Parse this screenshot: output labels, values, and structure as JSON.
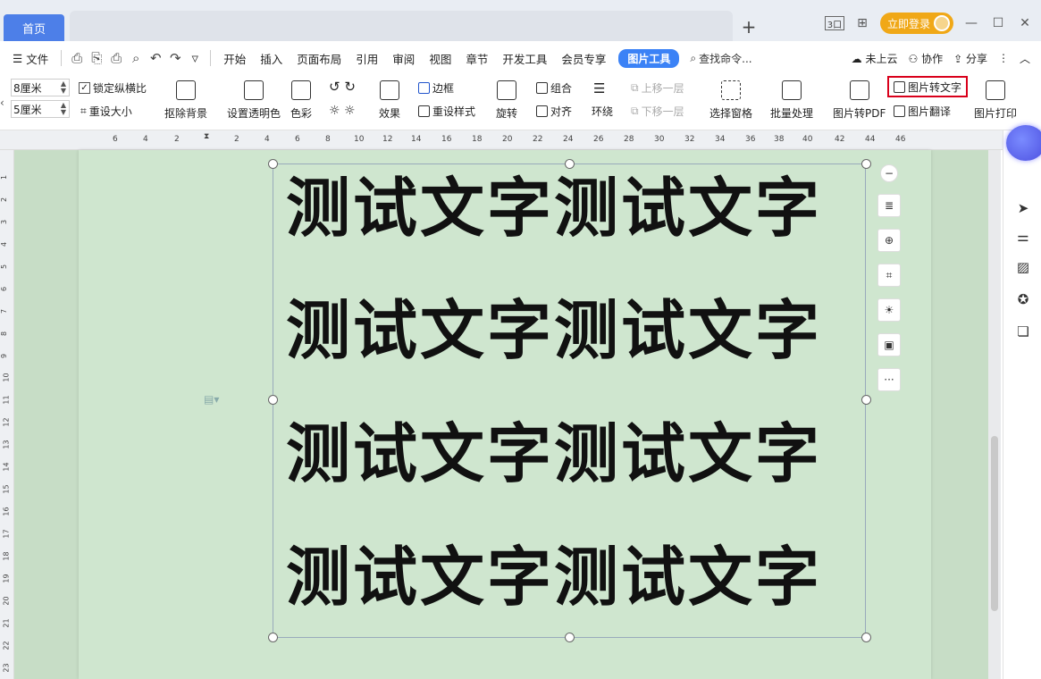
{
  "tabs": {
    "home": "首页",
    "new_tab": "+"
  },
  "title_right": {
    "view_icon": "3口",
    "login": "立即登录"
  },
  "menu": {
    "file": "文件",
    "items": [
      "开始",
      "插入",
      "页面布局",
      "引用",
      "审阅",
      "视图",
      "章节",
      "开发工具",
      "会员专享"
    ],
    "active": "图片工具",
    "search": "查找命令...",
    "right": [
      "未上云",
      "协作",
      "分享"
    ]
  },
  "ribbon": {
    "height_value": "8厘米",
    "width_value": "5厘米",
    "lock_ratio": "锁定纵横比",
    "reset_size": "重设大小",
    "remove_bg": "抠除背景",
    "set_transparent": "设置透明色",
    "color": "色彩",
    "effects": "效果",
    "border": "边框",
    "reset_style": "重设样式",
    "rotate": "旋转",
    "group": "组合",
    "align": "对齐",
    "wrap": "环绕",
    "bring_forward": "上移一层",
    "send_backward": "下移一层",
    "selection_pane": "选择窗格",
    "batch": "批量处理",
    "to_pdf": "图片转PDF",
    "to_text": "图片转文字",
    "translate": "图片翻译",
    "print": "图片打印"
  },
  "ruler_ticks": [
    "6",
    "4",
    "2",
    "2",
    "4",
    "6",
    "8",
    "10",
    "12",
    "14",
    "16",
    "18",
    "20",
    "22",
    "24",
    "26",
    "28",
    "30",
    "32",
    "34",
    "36",
    "38",
    "40",
    "42",
    "44",
    "46"
  ],
  "vruler_ticks": [
    "1",
    "2",
    "3",
    "4",
    "5",
    "6",
    "7",
    "8",
    "9",
    "10",
    "11",
    "12",
    "13",
    "14",
    "15",
    "16",
    "17",
    "18",
    "19",
    "20",
    "21",
    "22",
    "23"
  ],
  "image_text": {
    "line1": "测试文字测试文字",
    "line2": "测试文字测试文字",
    "line3": "测试文字测试文字",
    "line4": "测试文字测试文字"
  },
  "side_tools": {
    "more": "···"
  },
  "colors": {
    "accent": "#4d7fe8",
    "highlight": "#d9001b",
    "page_bg": "#cfe6cf",
    "login": "#f0a817"
  }
}
